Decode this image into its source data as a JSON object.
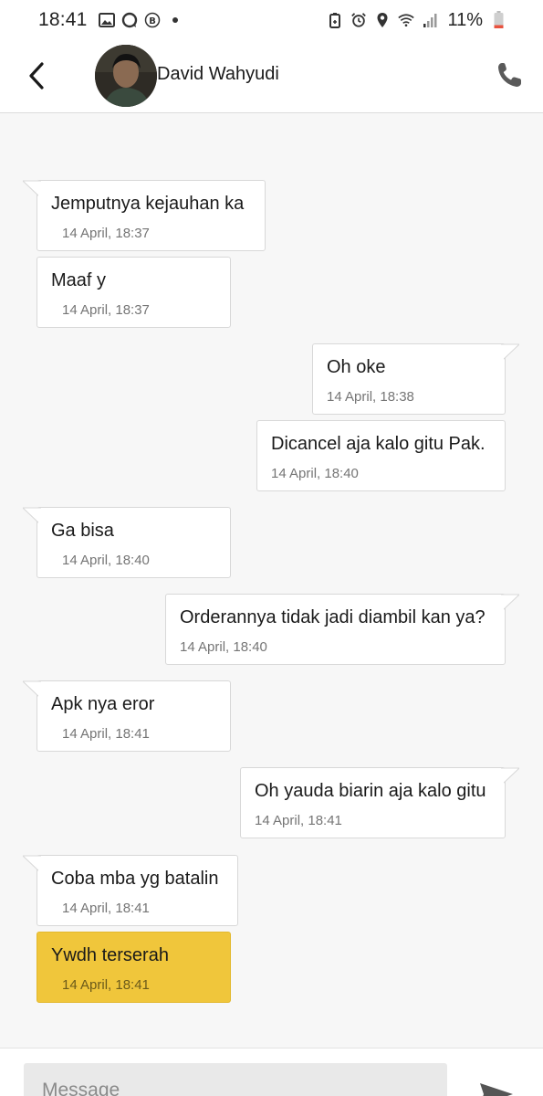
{
  "status_bar": {
    "time": "18:41",
    "battery": "11%"
  },
  "header": {
    "contact_name": "David Wahyudi"
  },
  "messages": [
    {
      "text": "Jemputnya kejauhan ka",
      "time": "14 April, 18:37",
      "direction": "incoming"
    },
    {
      "text": "Maaf y",
      "time": "14 April, 18:37",
      "direction": "incoming"
    },
    {
      "text": "Oh oke",
      "time": "14 April, 18:38",
      "direction": "outgoing"
    },
    {
      "text": "Dicancel aja kalo gitu Pak.",
      "time": "14 April, 18:40",
      "direction": "outgoing"
    },
    {
      "text": "Ga bisa",
      "time": "14 April, 18:40",
      "direction": "incoming"
    },
    {
      "text": "Orderannya tidak jadi diambil kan ya?",
      "time": "14 April, 18:40",
      "direction": "outgoing"
    },
    {
      "text": "Apk nya eror",
      "time": "14 April, 18:41",
      "direction": "incoming"
    },
    {
      "text": "Oh yauda biarin aja kalo gitu",
      "time": "14 April, 18:41",
      "direction": "outgoing"
    },
    {
      "text": "Coba mba yg batalin",
      "time": "14 April, 18:41",
      "direction": "incoming"
    },
    {
      "text": "Ywdh terserah",
      "time": "14 April, 18:41",
      "direction": "incoming",
      "highlighted": true
    }
  ],
  "composer": {
    "placeholder": "Message"
  },
  "colors": {
    "highlight": "#f0c63b",
    "bubble": "#ffffff",
    "background": "#f7f7f7"
  },
  "icons": {
    "back": "chevron-left-icon",
    "call": "phone-icon",
    "send": "send-icon"
  }
}
